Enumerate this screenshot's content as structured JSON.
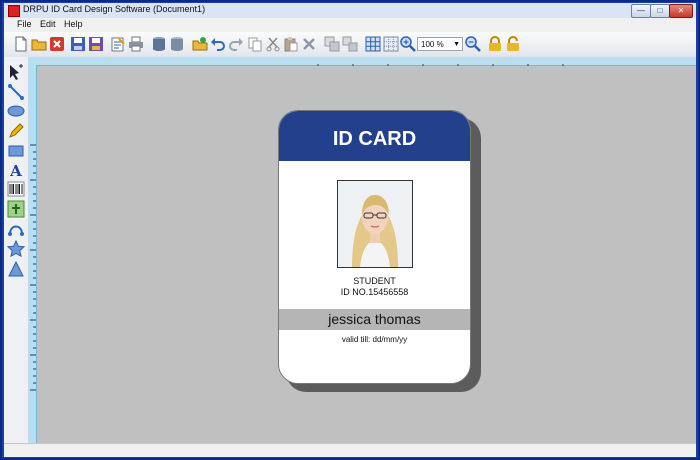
{
  "window": {
    "title": "DRPU ID Card Design Software  (Document1)",
    "min_symbol": "—",
    "max_symbol": "□",
    "close_symbol": "✕"
  },
  "menu": [
    "File",
    "Edit",
    "Help"
  ],
  "toolbar": {
    "icons": [
      "new-document-icon",
      "open-folder-icon",
      "close-document-icon",
      "save-icon",
      "save-as-icon",
      "properties-icon",
      "print-icon",
      "database-export-icon",
      "database-import-icon",
      "open-image-icon",
      "undo-icon",
      "redo-icon",
      "copy-icon",
      "cut-icon",
      "paste-icon",
      "delete-icon",
      "group-icon",
      "ungroup-icon",
      "grid-icon",
      "snap-grid-icon",
      "zoom-in-icon",
      "zoom-out-icon",
      "lock-icon",
      "unlock-icon"
    ],
    "zoom_value": "100 %"
  },
  "toolbox": {
    "icons": [
      "pointer-tool-icon",
      "line-tool-icon",
      "ellipse-tool-icon",
      "pencil-tool-icon",
      "rectangle-tool-icon",
      "text-tool-icon",
      "barcode-tool-icon",
      "image-tool-icon",
      "curve-tool-icon",
      "star-tool-icon",
      "triangle-tool-icon"
    ]
  },
  "card": {
    "header": "ID CARD",
    "role": "STUDENT",
    "id_number": "ID NO.15456558",
    "name": "jessica thomas",
    "valid_till": "valid till: dd/mm/yy",
    "header_color": "#23408d",
    "name_band_color": "#b5b5b5"
  },
  "colors": {
    "canvas": "#c0c0c0",
    "window_frame": "#1f3f9e",
    "ruler": "#b9def0"
  }
}
